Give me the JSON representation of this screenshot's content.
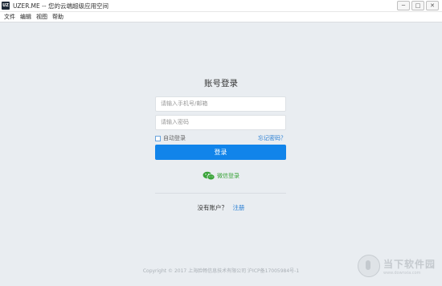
{
  "window": {
    "app_icon_text": "UZ",
    "title": "UZER.ME -- 您的云端超级应用空间",
    "minimize_symbol": "─",
    "maximize_symbol": "□",
    "close_symbol": "✕"
  },
  "menu": [
    "文件",
    "编辑",
    "视图",
    "帮助"
  ],
  "login": {
    "title": "账号登录",
    "phone_placeholder": "请输入手机号/邮箱",
    "password_placeholder": "请输入密码",
    "auto_login": "自动登录",
    "forgot_password": "忘记密码？",
    "login_button": "登录",
    "wechat_login": "微信登录",
    "no_account": "没有账户？",
    "register": "注册"
  },
  "footer": "Copyright © 2017 上海脸畅信息技术有限公司 沪ICP备17005984号-1",
  "watermark": {
    "text": "当下软件园",
    "sub": "www.downxia.com"
  },
  "colors": {
    "accent": "#1184ea",
    "link": "#2a7fd4",
    "wechat": "#3aa43a",
    "background": "#e9edf1"
  },
  "icons": {
    "wechat": "wechat-icon",
    "checkbox": "checkbox-icon",
    "app": "app-icon"
  }
}
